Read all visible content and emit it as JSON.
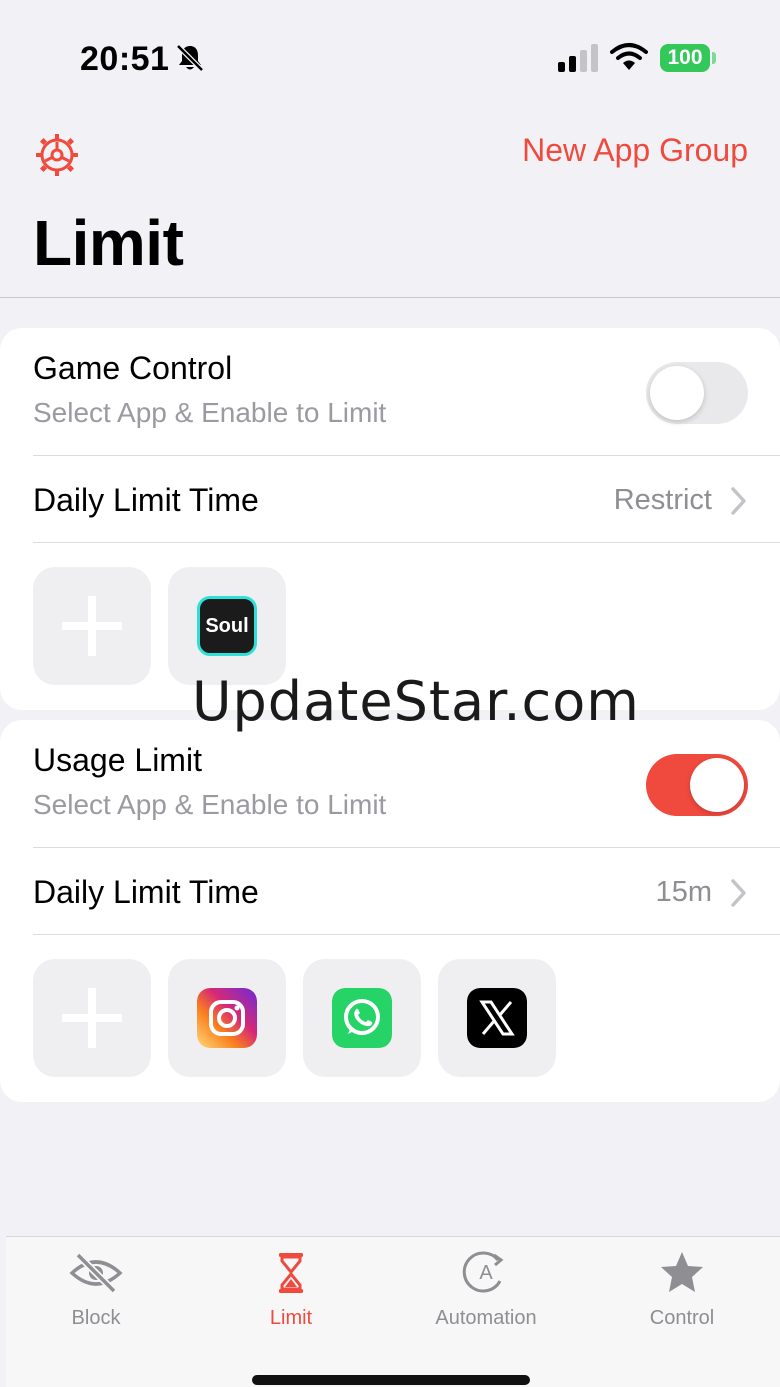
{
  "status_bar": {
    "time": "20:51",
    "battery": "100"
  },
  "header": {
    "new_group_label": "New App Group",
    "title": "Limit"
  },
  "game_control": {
    "title": "Game Control",
    "subtitle": "Select App & Enable to Limit",
    "enabled": false,
    "daily_label": "Daily Limit Time",
    "daily_value": "Restrict",
    "apps": [
      {
        "name": "Soul",
        "icon": "soul-app-icon"
      }
    ]
  },
  "usage_limit": {
    "title": "Usage Limit",
    "subtitle": "Select App & Enable to Limit",
    "enabled": true,
    "daily_label": "Daily Limit Time",
    "daily_value": "15m",
    "apps": [
      {
        "icon": "instagram-app-icon"
      },
      {
        "icon": "whatsapp-app-icon"
      },
      {
        "icon": "x-app-icon"
      }
    ]
  },
  "watermark": "UpdateStar.com",
  "tabs": [
    {
      "label": "Block",
      "icon": "eye-slash-icon",
      "active": false
    },
    {
      "label": "Limit",
      "icon": "hourglass-icon",
      "active": true
    },
    {
      "label": "Automation",
      "icon": "automation-icon",
      "active": false
    },
    {
      "label": "Control",
      "icon": "star-icon",
      "active": false
    }
  ],
  "colors": {
    "accent": "#f04a3e",
    "toggle_off": "#e9e9eb",
    "battery": "#34c759"
  }
}
